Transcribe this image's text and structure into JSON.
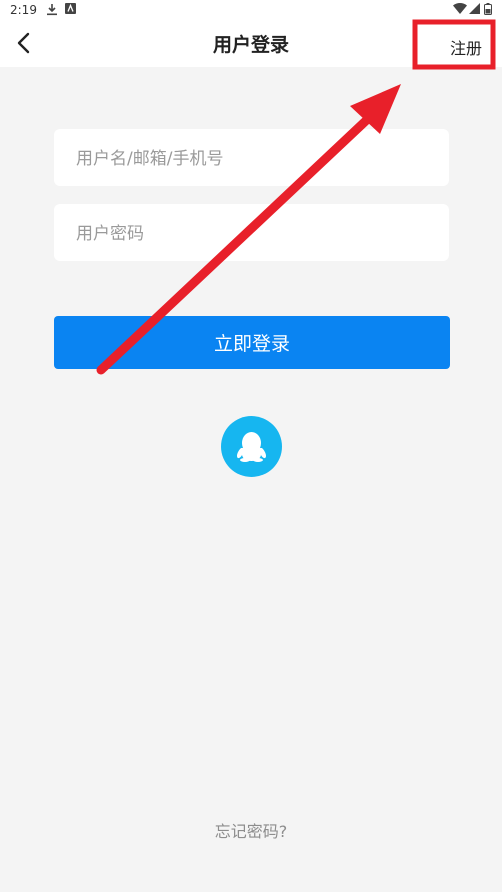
{
  "status_bar": {
    "time": "2:19",
    "icons": [
      "download-icon",
      "app-notification-icon",
      "wifi-icon",
      "signal-icon",
      "battery-icon"
    ]
  },
  "header": {
    "title": "用户登录",
    "register_label": "注册",
    "back_icon": "chevron-left-icon"
  },
  "form": {
    "username_placeholder": "用户名/邮箱/手机号",
    "password_placeholder": "用户密码",
    "username_value": "",
    "password_value": ""
  },
  "login_button": {
    "label": "立即登录"
  },
  "third_party": {
    "icon": "qq-icon"
  },
  "forgot_password": "忘记密码?",
  "colors": {
    "background": "#f4f4f4",
    "primary": "#0a84f2",
    "qq": "#16b6f0",
    "annotation": "#e8202a"
  }
}
